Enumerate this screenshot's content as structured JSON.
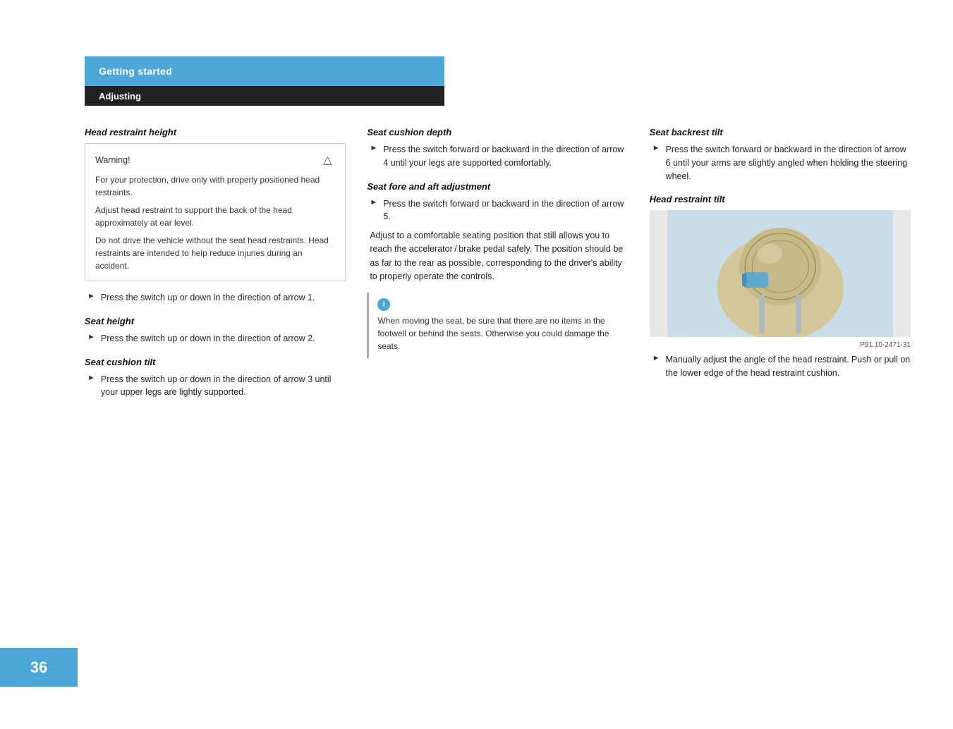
{
  "header": {
    "section": "Getting started",
    "subsection": "Adjusting"
  },
  "page_number": "36",
  "image_caption": "P91.10-2471-31",
  "columns": {
    "col1": {
      "head_restraint_height": {
        "title": "Head restraint height",
        "warning": {
          "label": "Warning!",
          "paragraphs": [
            "For your protection, drive only with properly positioned head restraints.",
            "Adjust head restraint to support the back of the head approximately at ear level.",
            "Do not drive the vehicle without the seat head restraints. Head restraints are intended to help reduce injuries during an accident."
          ]
        },
        "bullet": "Press the switch up or down in the direction of arrow 1."
      },
      "seat_height": {
        "title": "Seat height",
        "bullet": "Press the switch up or down in the direction of arrow 2."
      },
      "seat_cushion_tilt": {
        "title": "Seat cushion tilt",
        "bullet": "Press the switch up or down in the direction of arrow 3 until your upper legs are lightly supported."
      }
    },
    "col2": {
      "seat_cushion_depth": {
        "title": "Seat cushion depth",
        "bullet": "Press the switch forward or backward in the direction of arrow 4 until your legs are supported comfortably."
      },
      "seat_fore_aft": {
        "title": "Seat fore and aft adjustment",
        "bullet": "Press the switch forward or backward in the direction of arrow 5.",
        "body": "Adjust to a comfortable seating position that still allows you to reach the accelerator / brake pedal safely. The position should be as far to the rear as possible, corresponding to the driver's ability to properly operate the controls."
      },
      "info": {
        "text": "When moving the seat, be sure that there are no items in the footwell or behind the seats. Otherwise you could damage the seats."
      }
    },
    "col3": {
      "seat_backrest_tilt": {
        "title": "Seat backrest tilt",
        "bullet": "Press the switch forward or backward in the direction of arrow 6 until your arms are slightly angled when holding the steering wheel."
      },
      "head_restraint_tilt": {
        "title": "Head restraint tilt",
        "bullet": "Manually adjust the angle of the head restraint. Push or pull on the lower edge of the head restraint cushion."
      }
    }
  }
}
